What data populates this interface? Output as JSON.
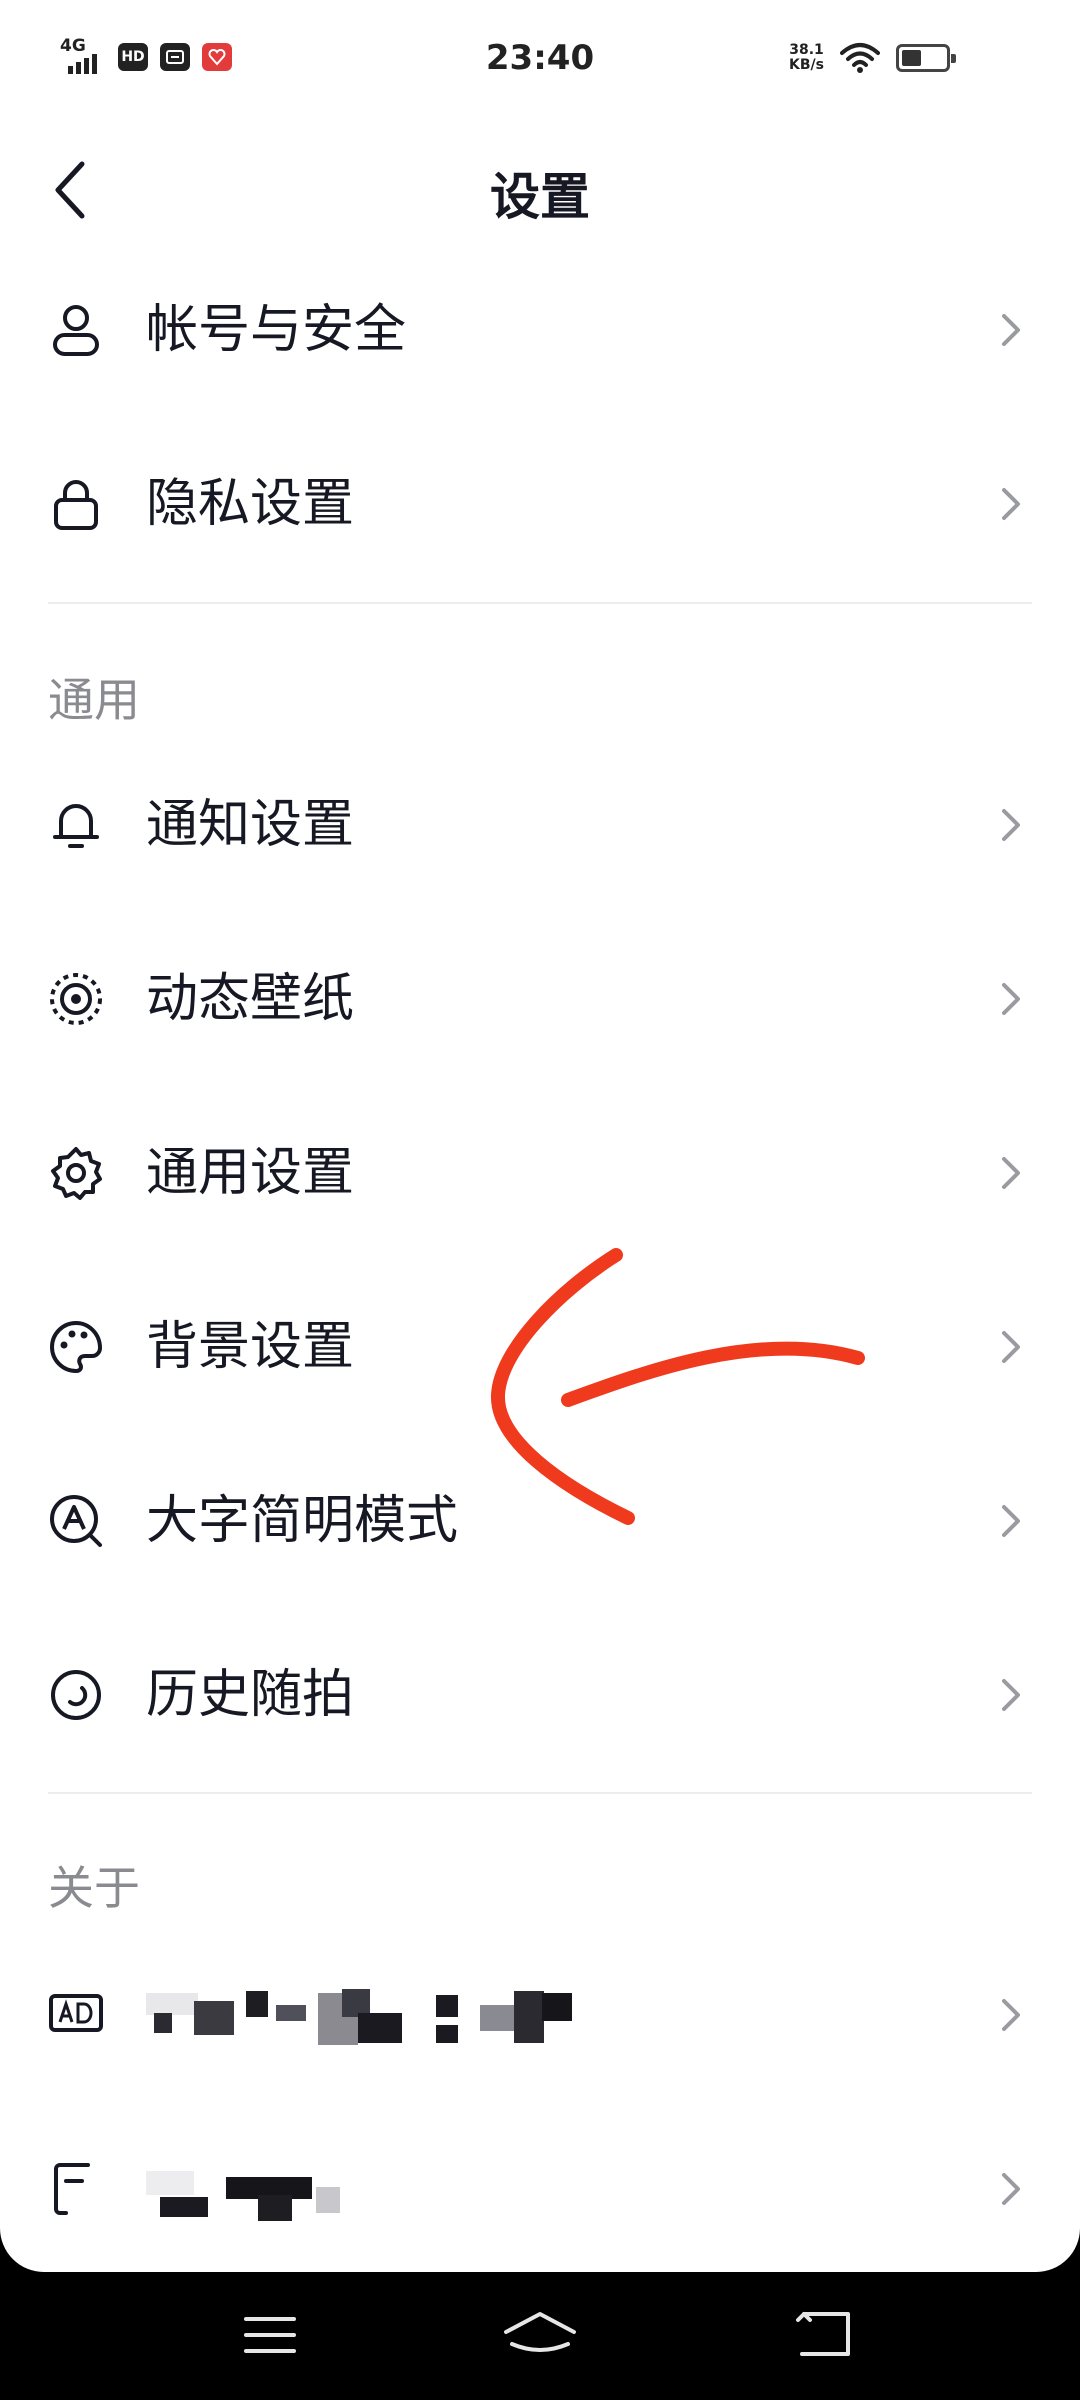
{
  "status_bar": {
    "network": "4G",
    "hd_badge": "HD",
    "time": "23:40",
    "net_speed_value": "38.1",
    "net_speed_unit": "KB/s",
    "battery_level": 0.45,
    "icons": [
      "signal-icon",
      "hd-icon",
      "app-notification-icon",
      "app-notification-red-icon",
      "wifi-icon",
      "battery-icon"
    ]
  },
  "header": {
    "title": "设置",
    "back_icon": "back-arrow-icon"
  },
  "account_section": {
    "items": [
      {
        "label": "帐号与安全",
        "icon": "user-icon"
      },
      {
        "label": "隐私设置",
        "icon": "lock-icon"
      }
    ]
  },
  "general_section": {
    "title": "通用",
    "items": [
      {
        "label": "通知设置",
        "icon": "bell-icon"
      },
      {
        "label": "动态壁纸",
        "icon": "dynamic-wallpaper-icon"
      },
      {
        "label": "通用设置",
        "icon": "gear-icon"
      },
      {
        "label": "背景设置",
        "icon": "palette-icon"
      },
      {
        "label": "大字简明模式",
        "icon": "large-font-icon"
      },
      {
        "label": "历史随拍",
        "icon": "history-icon"
      }
    ]
  },
  "about_section": {
    "title": "关于",
    "items": [
      {
        "label": "",
        "icon": "ad-icon",
        "redacted": true
      },
      {
        "label": "",
        "icon": "document-icon",
        "redacted": true
      }
    ]
  },
  "annotation": {
    "color": "#f03a1e",
    "shape": "hand-drawn-arrow"
  },
  "nav_bar": {
    "icons": [
      "menu-icon",
      "home-icon",
      "back-icon"
    ]
  },
  "colors": {
    "text": "#161823",
    "secondary": "#8a8b91",
    "divider": "#ececec",
    "chevron": "#9a9ba0"
  }
}
